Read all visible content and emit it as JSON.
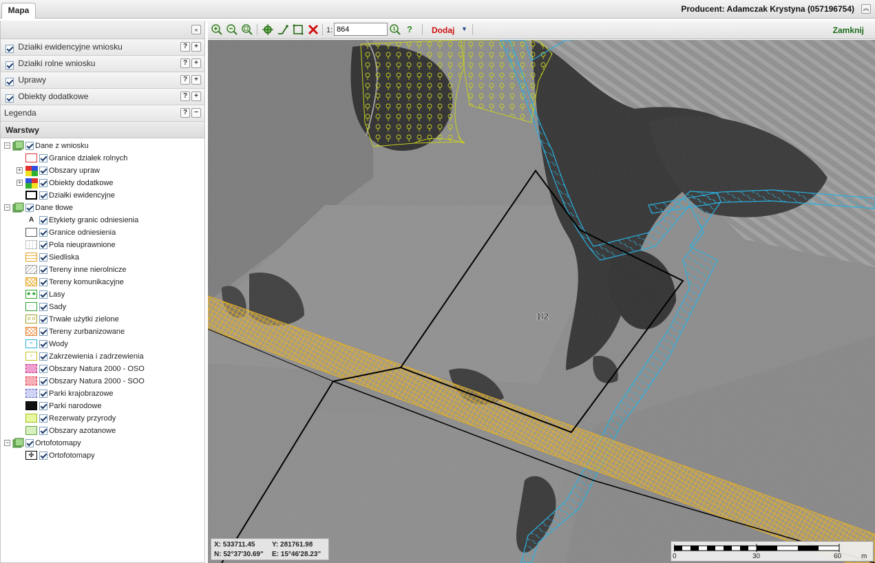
{
  "header": {
    "tab_label": "Mapa",
    "producer": "Producent: Adamczak Krystyna (057196754)",
    "collapse_symbol": "«"
  },
  "sidebar": {
    "collapse_symbol": "«",
    "sections": [
      {
        "label": "Działki ewidencyjne wniosku",
        "checked": true,
        "plus": "+",
        "help": "?"
      },
      {
        "label": "Działki rolne wniosku",
        "checked": true,
        "plus": "+",
        "help": "?"
      },
      {
        "label": "Uprawy",
        "checked": true,
        "plus": "+",
        "help": "?"
      },
      {
        "label": "Obiekty dodatkowe",
        "checked": true,
        "plus": "+",
        "help": "?"
      }
    ],
    "legend": {
      "label": "Legenda",
      "help": "?",
      "minus": "−"
    },
    "layers_header": "Warstwy",
    "tree": {
      "group1": {
        "label": "Dane z wniosku",
        "expander": "−"
      },
      "group1_items": [
        {
          "label": "Granice działek rolnych"
        },
        {
          "label": "Obszary upraw",
          "expander": "+"
        },
        {
          "label": "Obiekty dodatkowe",
          "expander": "+"
        },
        {
          "label": "Działki ewidencyjne"
        }
      ],
      "group2": {
        "label": "Dane tłowe",
        "expander": "−"
      },
      "group2_items": [
        {
          "label": "Etykiety granic odniesienia",
          "glyph": "A"
        },
        {
          "label": "Granice odniesienia"
        },
        {
          "label": "Pola nieuprawnione"
        },
        {
          "label": "Siedliska"
        },
        {
          "label": "Tereny inne nierolnicze"
        },
        {
          "label": "Tereny komunikacyjne"
        },
        {
          "label": "Lasy"
        },
        {
          "label": "Sady"
        },
        {
          "label": "Trwałe użytki zielone"
        },
        {
          "label": "Tereny zurbanizowane"
        },
        {
          "label": "Wody"
        },
        {
          "label": "Zakrzewienia i zadrzewienia"
        },
        {
          "label": "Obszary Natura 2000 - OSO"
        },
        {
          "label": "Obszary Natura 2000 - SOO"
        },
        {
          "label": "Parki krajobrazowe"
        },
        {
          "label": "Parki narodowe"
        },
        {
          "label": "Rezerwaty przyrody"
        },
        {
          "label": "Obszary azotanowe"
        }
      ],
      "group3": {
        "label": "Ortofotomapy",
        "expander": "−"
      },
      "group3_items": [
        {
          "label": "Ortofotomapy"
        }
      ]
    }
  },
  "toolbar": {
    "scale_prefix": "1:",
    "scale_value": "864",
    "dodaj_label": "Dodaj",
    "dodaj_arrow": "▼",
    "help_label": "?",
    "zamknij_label": "Zamknij",
    "icons": [
      "zoom-in-icon",
      "zoom-out-icon",
      "zoom-extent-icon",
      "pan-center-icon",
      "measure-line-icon",
      "measure-area-icon",
      "clear-icon",
      "zoom-scale-icon",
      "help-icon"
    ]
  },
  "map": {
    "parcel_label": "1/2",
    "coords": {
      "x": "X: 533711.45",
      "y": "Y: 281761.98",
      "n": "N: 52°37'30.69\"",
      "e": "E: 15°46'28.23\""
    },
    "scalebar": {
      "ticks": [
        "0",
        "30",
        "60"
      ],
      "unit": "m"
    },
    "colors": {
      "water": "#2ab0e0",
      "orchard": "#c8d020",
      "road": "#e6b020",
      "parcel": "#000000"
    }
  }
}
